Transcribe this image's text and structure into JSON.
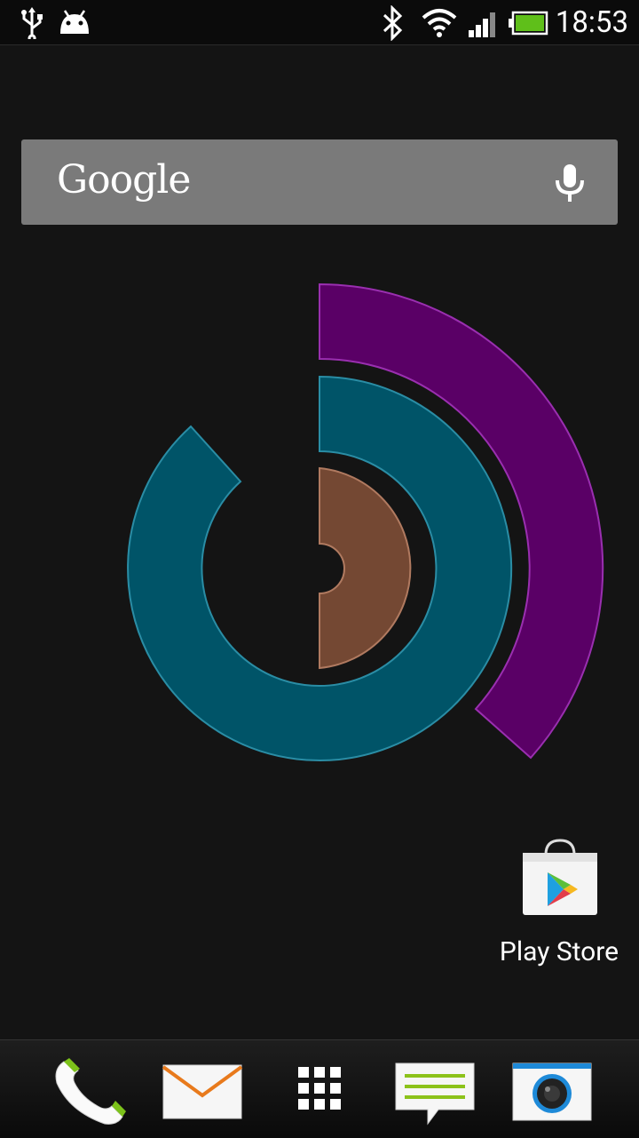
{
  "status_bar": {
    "time": "18:53",
    "left_icons": [
      "usb-icon",
      "android-debug-icon"
    ],
    "right_icons": [
      "bluetooth-icon",
      "wifi-icon",
      "signal-icon",
      "battery-icon"
    ]
  },
  "search": {
    "logo": "Google",
    "mic_icon": "microphone-icon"
  },
  "widget": {
    "icon": "concentric-rings-widget",
    "colors": {
      "outer_arc": "#5a0066",
      "middle_ring": "#005468",
      "inner_half": "#744833"
    }
  },
  "desktop_apps": [
    {
      "label": "Play Store",
      "icon": "play-store-icon"
    }
  ],
  "dock": {
    "items": [
      {
        "icon": "phone-icon"
      },
      {
        "icon": "mail-icon"
      },
      {
        "icon": "app-drawer-icon"
      },
      {
        "icon": "messages-icon"
      },
      {
        "icon": "camera-icon"
      }
    ]
  },
  "colors": {
    "background": "#141414",
    "search_bg": "#7a7a7a",
    "battery_fill": "#5fbf1a"
  }
}
